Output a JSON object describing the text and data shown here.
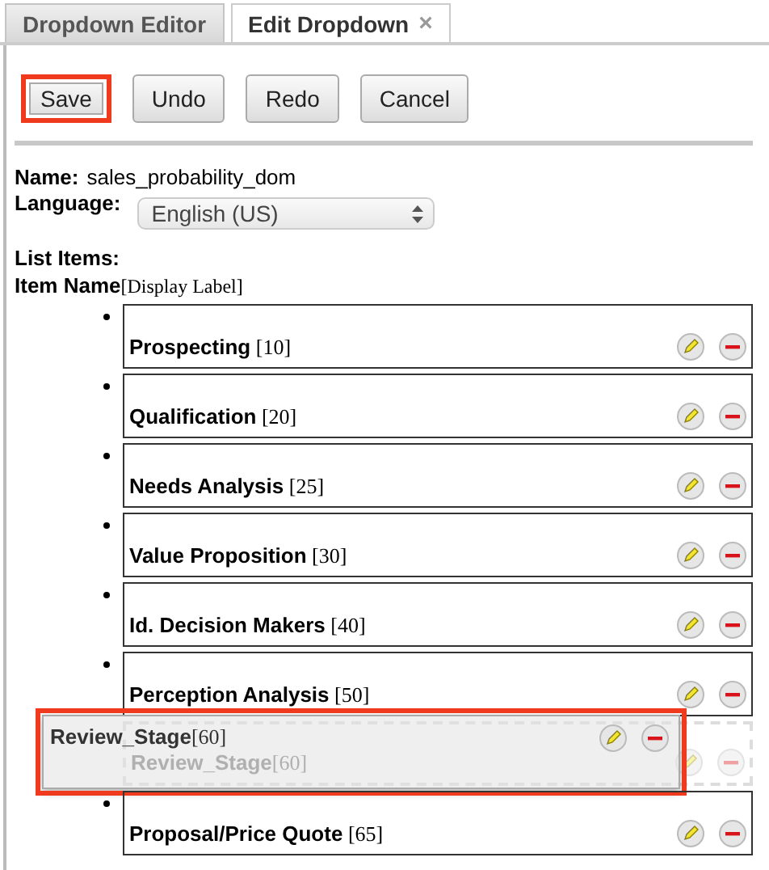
{
  "tabs": [
    {
      "label": "Dropdown Editor",
      "selected": false,
      "closable": false
    },
    {
      "label": "Edit Dropdown",
      "selected": true,
      "closable": true,
      "close": "×"
    }
  ],
  "buttons": [
    {
      "label": "Save",
      "highlighted": true
    },
    {
      "label": "Undo",
      "highlighted": false
    },
    {
      "label": "Redo",
      "highlighted": false
    },
    {
      "label": "Cancel",
      "highlighted": false
    }
  ],
  "name": {
    "label": "Name:",
    "value": "sales_probability_dom"
  },
  "language": {
    "label": "Language:",
    "value": "English (US)"
  },
  "list_items_label": "List Items:",
  "list_header": "**Item Name**[Display Label]",
  "items": [
    {
      "kind": "item",
      "label": "**Prospecting** [10]"
    },
    {
      "kind": "item",
      "label": "**Qualification** [20]"
    },
    {
      "kind": "item",
      "label": "**Needs Analysis** [25]"
    },
    {
      "kind": "item",
      "label": "**Value Proposition** [30]"
    },
    {
      "kind": "item",
      "label": "**Id. Decision Makers** [40]"
    },
    {
      "kind": "item",
      "label": "**Perception Analysis** [50]"
    },
    {
      "kind": "placeholder",
      "label": "**Review_Stage**[60]",
      "dragged": {
        "label": "**Review_Stage**[60]",
        "highlighted": true
      }
    },
    {
      "kind": "item",
      "label": "**Proposal/Price Quote** [65]"
    }
  ]
}
